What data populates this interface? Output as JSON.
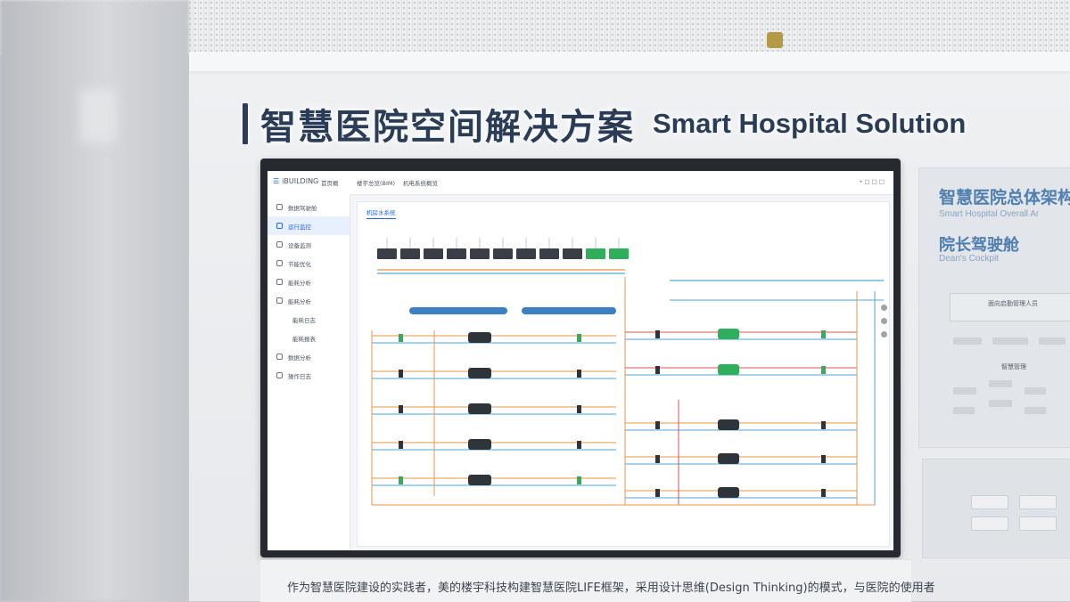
{
  "sign": {
    "title_cn": "智慧医院空间解决方案",
    "title_en": "Smart Hospital Solution"
  },
  "monitor": {
    "logo": "iBUILDING",
    "tabs": [
      "首页概",
      "楼宇总览(BIM)",
      "机电系统概览"
    ],
    "topbar_right": "• □ □ □",
    "sidebar": [
      {
        "label": "数据驾驶舱",
        "active": false,
        "sub": false
      },
      {
        "label": "运行监控",
        "active": true,
        "sub": false
      },
      {
        "label": "设备监测",
        "active": false,
        "sub": false
      },
      {
        "label": "节能优化",
        "active": false,
        "sub": false
      },
      {
        "label": "能耗分析",
        "active": false,
        "sub": false
      },
      {
        "label": "能耗分析",
        "active": false,
        "sub": false
      },
      {
        "label": "能耗日志",
        "active": false,
        "sub": true
      },
      {
        "label": "能耗报表",
        "active": false,
        "sub": true
      },
      {
        "label": "数据分析",
        "active": false,
        "sub": false
      },
      {
        "label": "操作日志",
        "active": false,
        "sub": false
      }
    ],
    "content_tab": "机房水系统"
  },
  "right_panel": {
    "title_cn": "智慧医院总体架构",
    "title_en": "Smart Hospital Overall Ar",
    "sub_cn": "院长驾驶舱",
    "sub_en": "Dean's Cockpit",
    "box_title": "面向启勤管理人员",
    "section2": "智慧管理"
  },
  "caption": {
    "text": "作为智慧医院建设的实践者，美的楼宇科技构建智慧医院LIFE框架，采用设计思维(Design    Thinking)的模式，与医院的使用者"
  },
  "colors": {
    "sign_text": "#2a3c56",
    "accent_blue": "#2563eb",
    "pipe_orange": "#e8964a",
    "pipe_blue": "#4ea6d8",
    "pump_green": "#2fae5b"
  }
}
